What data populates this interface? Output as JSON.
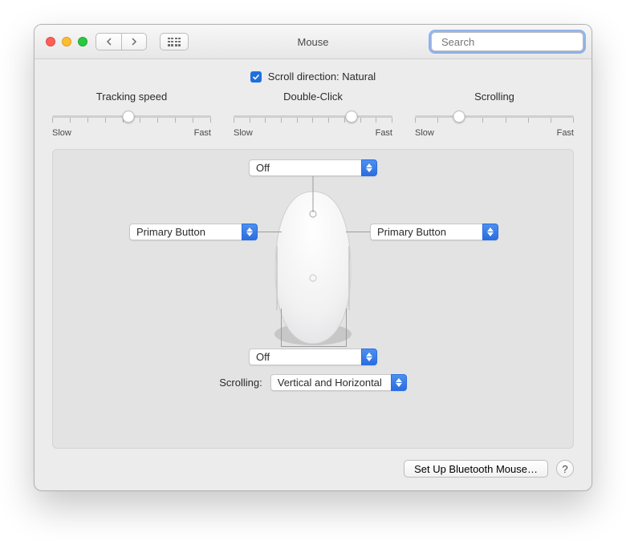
{
  "titlebar": {
    "title": "Mouse",
    "search_placeholder": "Search"
  },
  "scroll_direction": {
    "checked": true,
    "label": "Scroll direction: Natural"
  },
  "sliders": {
    "tracking": {
      "label": "Tracking speed",
      "min": "Slow",
      "max": "Fast",
      "value_pct": 48
    },
    "doubleclick": {
      "label": "Double-Click",
      "min": "Slow",
      "max": "Fast",
      "value_pct": 74
    },
    "scrolling": {
      "label": "Scrolling",
      "min": "Slow",
      "max": "Fast",
      "value_pct": 28
    }
  },
  "mouse": {
    "top": {
      "value": "Off"
    },
    "left": {
      "value": "Primary Button"
    },
    "right": {
      "value": "Primary Button"
    },
    "bottom": {
      "value": "Off"
    },
    "scrolling_label": "Scrolling:",
    "scrolling_value": "Vertical and Horizontal"
  },
  "footer": {
    "setup_bluetooth": "Set Up Bluetooth Mouse…",
    "help": "?"
  }
}
